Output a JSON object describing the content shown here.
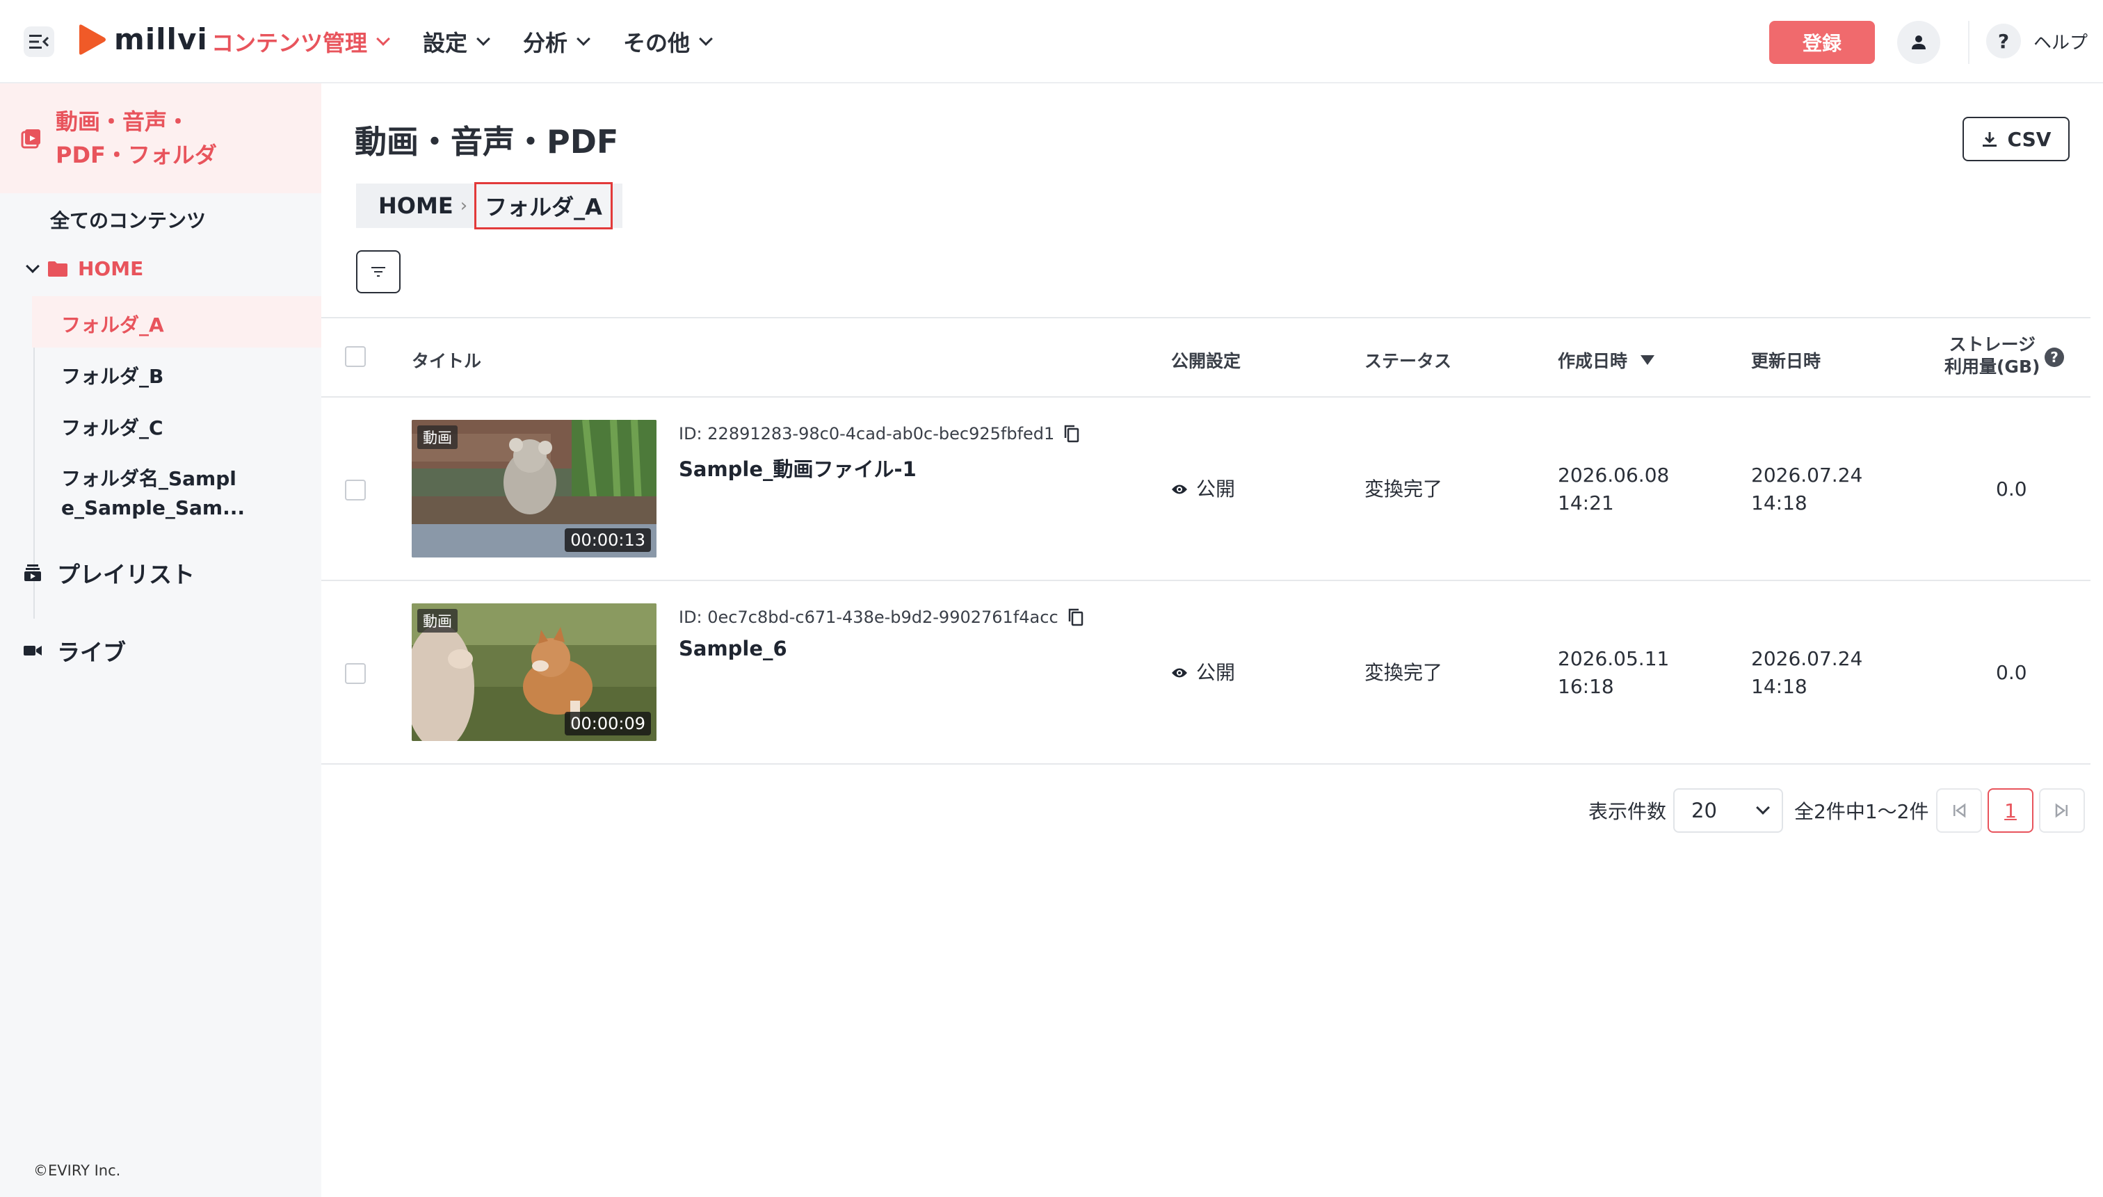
{
  "header": {
    "logo_text": "millvi",
    "nav": [
      {
        "label": "コンテンツ管理",
        "active": true
      },
      {
        "label": "設定"
      },
      {
        "label": "分析"
      },
      {
        "label": "その他"
      }
    ],
    "register_label": "登録",
    "help_label": "ヘルプ",
    "help_glyph": "?"
  },
  "sidebar": {
    "section_title_line1": "動画・音声・",
    "section_title_line2": "PDF・フォルダ",
    "all_contents": "全てのコンテンツ",
    "home": "HOME",
    "folders": [
      "フォルダ_A",
      "フォルダ_B",
      "フォルダ_C"
    ],
    "long_folder_line1": "フォルダ名_Sampl",
    "long_folder_line2": "e_Sample_Sam...",
    "playlist": "プレイリスト",
    "live": "ライブ",
    "copyright": "©EVIRY Inc."
  },
  "main": {
    "title": "動画・音声・PDF",
    "csv_label": "CSV",
    "breadcrumb": {
      "home": "HOME",
      "separator": "›",
      "current": "フォルダ_A"
    }
  },
  "table": {
    "headers": {
      "title": "タイトル",
      "visibility": "公開設定",
      "status": "ステータス",
      "created": "作成日時",
      "updated": "更新日時",
      "storage_line1": "ストレージ",
      "storage_line2": "利用量(GB)"
    },
    "rows": [
      {
        "tag": "動画",
        "duration": "00:00:13",
        "id": "ID: 22891283-98c0-4cad-ab0c-bec925fbfed1",
        "title": "Sample_動画ファイル-1",
        "visibility": "公開",
        "status": "変換完了",
        "created_date": "2026.06.08",
        "created_time": "14:21",
        "updated_date": "2026.07.24",
        "updated_time": "14:18",
        "storage": "0.0"
      },
      {
        "tag": "動画",
        "duration": "00:00:09",
        "id": "ID: 0ec7c8bd-c671-438e-b9d2-9902761f4acc",
        "title": "Sample_6",
        "visibility": "公開",
        "status": "変換完了",
        "created_date": "2026.05.11",
        "created_time": "16:18",
        "updated_date": "2026.07.24",
        "updated_time": "14:18",
        "storage": "0.0"
      }
    ]
  },
  "pagination": {
    "per_page_label": "表示件数",
    "per_page_value": "20",
    "summary": "全2件中1〜2件",
    "current_page": "1"
  },
  "colors": {
    "accent": "#e8545c",
    "register_bg": "#f06a6d",
    "sidebar_bg": "#f6f7f9"
  }
}
